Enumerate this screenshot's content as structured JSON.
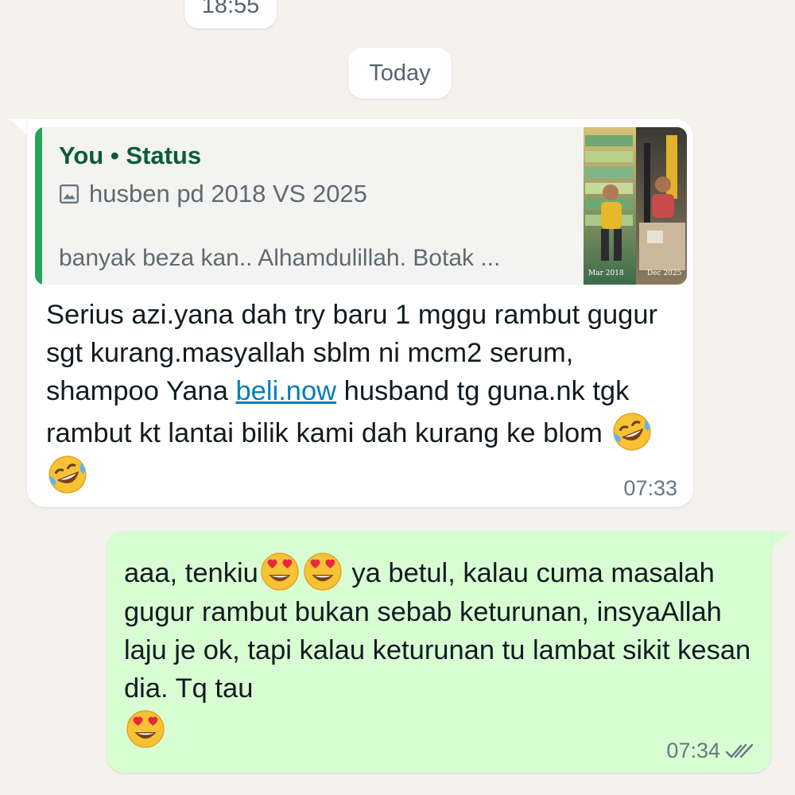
{
  "date_chips": {
    "previous_time": "18:55",
    "today": "Today"
  },
  "incoming": {
    "quote": {
      "author": "You • Status",
      "media_icon": "photo-icon",
      "title": "husben pd 2018 VS 2025",
      "caption": "banyak beza kan.. Alhamdulillah. Botak ...",
      "thumbnail_left_label": "Mar 2018",
      "thumbnail_right_label": "Dec 2025"
    },
    "text_before_link": "Serius azi.yana dah try baru 1 mggu rambut gugur sgt kurang.masyallah sblm ni mcm2 serum, shampoo Yana ",
    "link_text": "beli.now",
    "text_after_link": " husband tg guna.nk tgk rambut kt  lantai bilik kami dah kurang ke blom ",
    "emojis": [
      "rolling-laughing-emoji",
      "rolling-laughing-emoji"
    ],
    "time": "07:33"
  },
  "outgoing": {
    "text_part1": "aaa, tenkiu",
    "emojis_inline": [
      "heart-eyes-emoji",
      "heart-eyes-emoji"
    ],
    "text_part2": " ya betul, kalau cuma masalah gugur rambut bukan sebab keturunan, insyaAllah laju je ok, tapi kalau keturunan tu lambat sikit kesan dia. Tq tau",
    "emoji_end": "heart-eyes-emoji",
    "time": "07:34",
    "status_icon": "double-check-icon"
  },
  "colors": {
    "background": "#f5f2ed",
    "incoming_bubble": "#ffffff",
    "outgoing_bubble": "#d9fdd3",
    "quote_bar": "#25a45a",
    "quote_author": "#0b5c3b",
    "link": "#027eb5",
    "timestamp": "#667781"
  }
}
